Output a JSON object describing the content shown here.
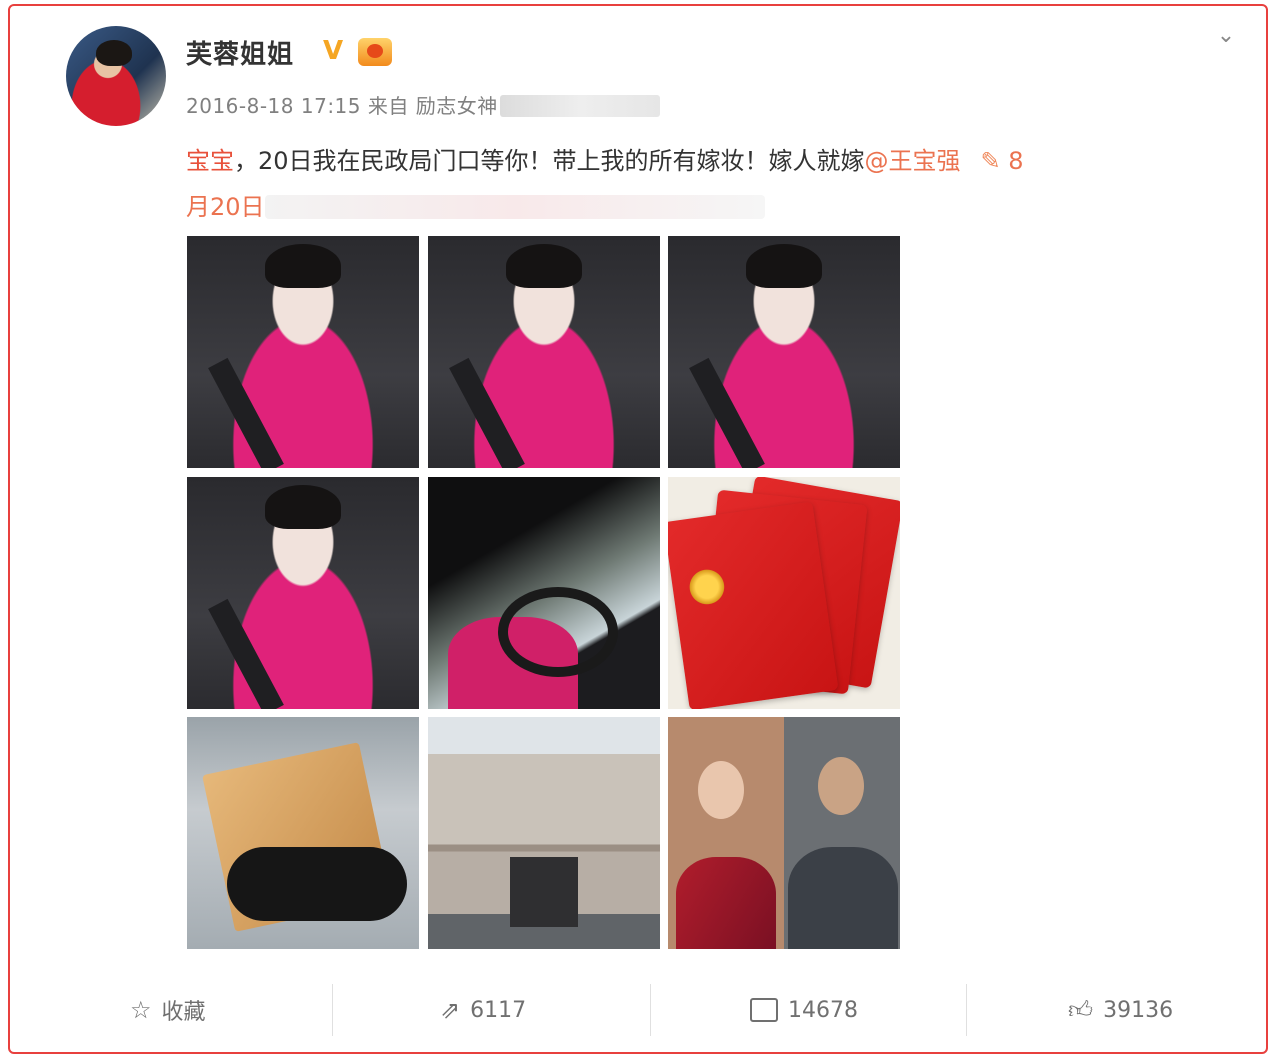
{
  "post": {
    "username": "芙蓉姐姐",
    "verified_icon": "verified-v-icon",
    "member_icon": "member-badge-icon",
    "menu_icon": "chevron-down-icon",
    "timestamp": "2016-8-18 17:15",
    "source_prefix": "来自",
    "source_visible": "励志女神",
    "text_tag": "宝宝",
    "text_body": "，20日我在民政局门口等你！带上我的所有嫁妆！嫁人就嫁",
    "text_mention": "@王宝强",
    "text_tail_icon": "paperclip-icon",
    "text_tail_num": "8",
    "text_line2": "月20日"
  },
  "photos": [
    {
      "name": "selfie-1"
    },
    {
      "name": "selfie-2"
    },
    {
      "name": "selfie-3"
    },
    {
      "name": "selfie-4"
    },
    {
      "name": "driving-selfie"
    },
    {
      "name": "red-books"
    },
    {
      "name": "keys-and-cards"
    },
    {
      "name": "building"
    },
    {
      "name": "couple-photo"
    }
  ],
  "actions": {
    "favorite_icon": "star-icon",
    "favorite_label": "收藏",
    "share_icon": "share-icon",
    "share_count": "6117",
    "comment_icon": "comment-icon",
    "comment_count": "14678",
    "like_icon": "thumbs-up-icon",
    "like_count": "39136"
  },
  "colors": {
    "border": "#e8403e",
    "mention": "#eb7350",
    "tag": "#e8503a",
    "verified": "#f5a623"
  }
}
